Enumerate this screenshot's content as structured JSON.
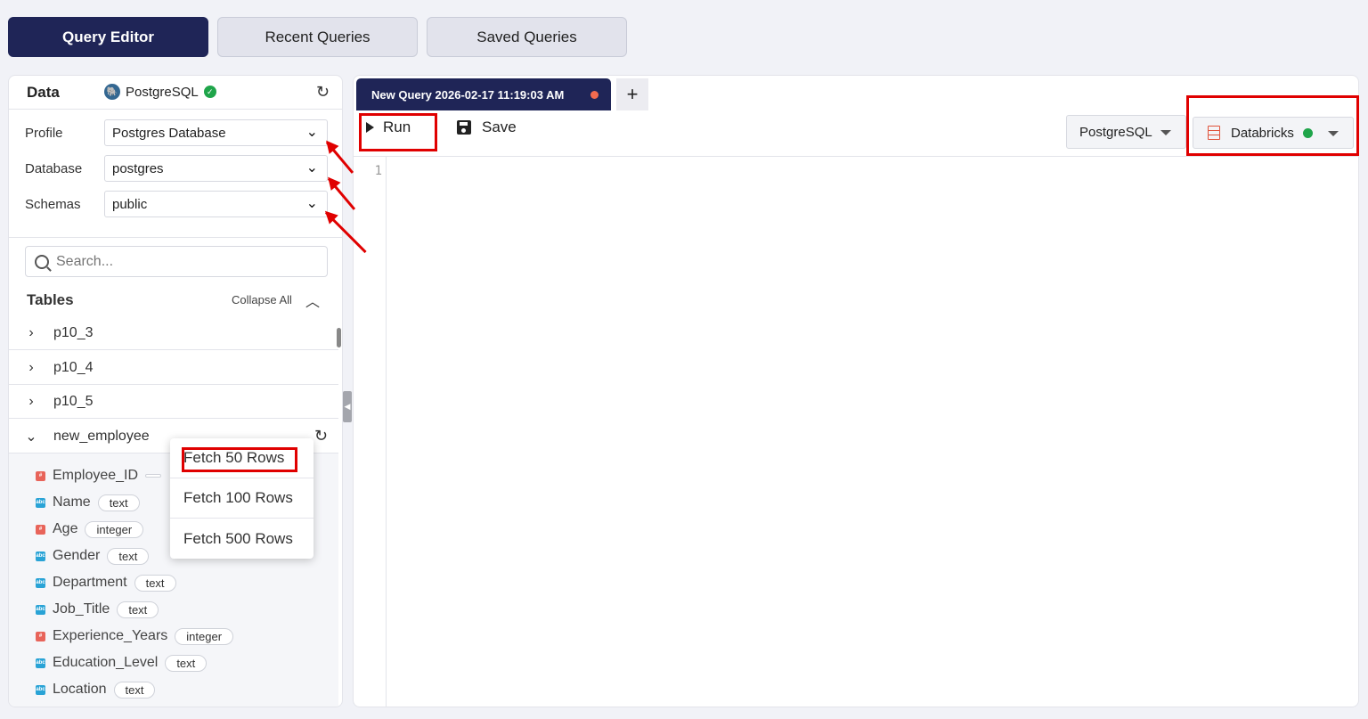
{
  "top_tabs": [
    {
      "label": "Query Editor",
      "active": true
    },
    {
      "label": "Recent Queries",
      "active": false
    },
    {
      "label": "Saved Queries",
      "active": false
    }
  ],
  "left": {
    "title": "Data",
    "db_name": "PostgreSQL",
    "profile_label": "Profile",
    "profile_value": "Postgres Database",
    "database_label": "Database",
    "database_value": "postgres",
    "schemas_label": "Schemas",
    "schemas_value": "public",
    "search_placeholder": "Search...",
    "tables_title": "Tables",
    "collapse_all": "Collapse All",
    "tables": [
      "p10_3",
      "p10_4",
      "p10_5",
      "new_employee"
    ],
    "columns": [
      {
        "name": "Employee_ID",
        "type": "",
        "kind": "num"
      },
      {
        "name": "Name",
        "type": "text",
        "kind": "str"
      },
      {
        "name": "Age",
        "type": "integer",
        "kind": "num"
      },
      {
        "name": "Gender",
        "type": "text",
        "kind": "str"
      },
      {
        "name": "Department",
        "type": "text",
        "kind": "str"
      },
      {
        "name": "Job_Title",
        "type": "text",
        "kind": "str"
      },
      {
        "name": "Experience_Years",
        "type": "integer",
        "kind": "num"
      },
      {
        "name": "Education_Level",
        "type": "text",
        "kind": "str"
      },
      {
        "name": "Location",
        "type": "text",
        "kind": "str"
      }
    ]
  },
  "popup": {
    "items": [
      "Fetch 50 Rows",
      "Fetch 100 Rows",
      "Fetch 500 Rows"
    ]
  },
  "editor": {
    "tab_title": "New Query 2026-02-17 11:19:03 AM",
    "add_tab": "+",
    "run_label": "Run",
    "save_label": "Save",
    "dialect": "PostgreSQL",
    "connection": "Databricks",
    "line_number": "1"
  },
  "colors": {
    "navy": "#1f2557",
    "annotation_red": "#e00000",
    "status_green": "#1fa54a",
    "unsaved_dot": "#f26b4f"
  }
}
